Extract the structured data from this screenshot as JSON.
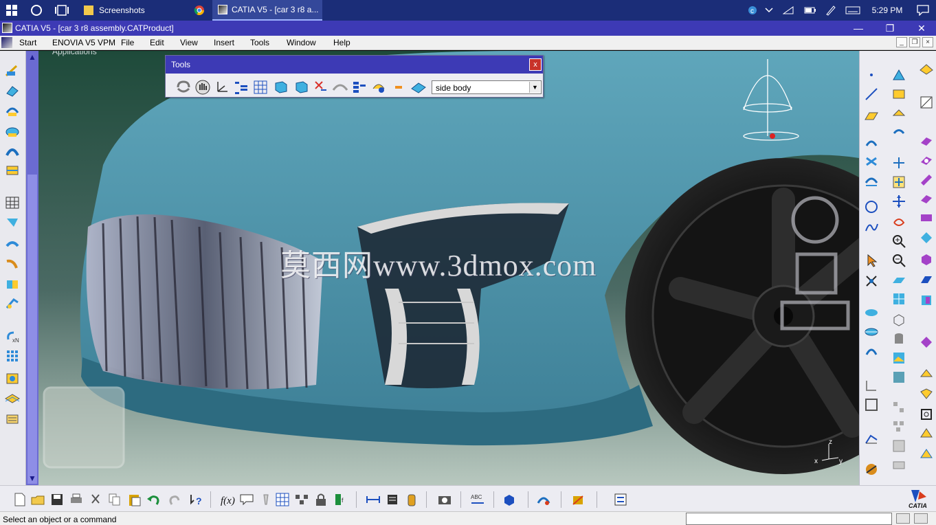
{
  "taskbar": {
    "apps": [
      {
        "label": "Screenshots",
        "icon": "folder-icon"
      },
      {
        "label": "",
        "icon": "chrome-icon"
      },
      {
        "label": "CATIA V5 - [car 3 r8 a...",
        "icon": "catia-icon"
      }
    ],
    "clock": "5:29 PM"
  },
  "window": {
    "title": "CATIA V5 - [car 3 r8 assembly.CATProduct]"
  },
  "menubar": {
    "items": [
      "Start",
      "ENOVIA V5 VPM",
      "File",
      "Edit",
      "View",
      "Insert",
      "Tools",
      "Window",
      "Help"
    ]
  },
  "viewport": {
    "tree_root_label": "Applications",
    "watermark": "莫西网www.3dmox.com",
    "compass_axes": {
      "x": "x",
      "y": "y",
      "z": "z"
    }
  },
  "tools_toolbar": {
    "title": "Tools",
    "close_label": "x",
    "layer_value": "side body"
  },
  "statusbar": {
    "message": "Select an object or a command",
    "command_input_value": ""
  },
  "brand": {
    "logo_text": "CATIA"
  },
  "colors": {
    "taskbar": "#1b2d78",
    "titlebar": "#3d3ab5",
    "car_body": "#4a8fa3",
    "scroll_track": "#6b6bd1"
  }
}
